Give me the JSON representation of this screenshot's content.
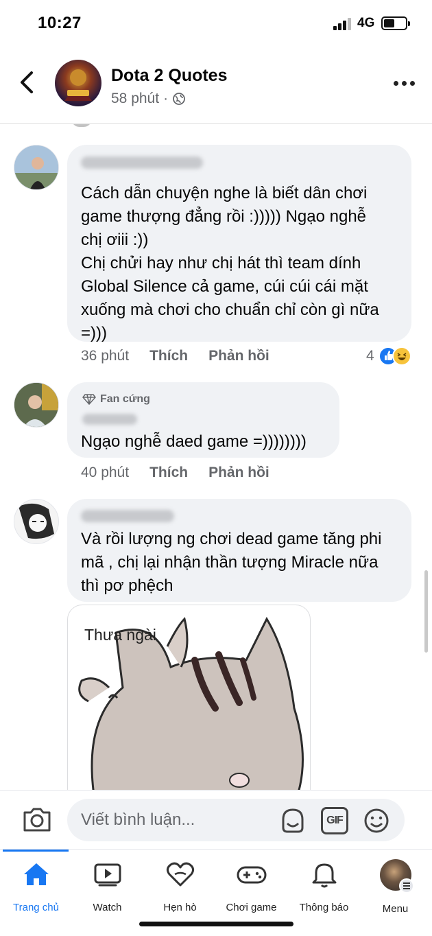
{
  "status": {
    "time": "10:27",
    "network": "4G"
  },
  "header": {
    "title": "Dota 2 Quotes",
    "subtitle": "58 phút",
    "separator": "·"
  },
  "comments": [
    {
      "badge": "",
      "text": "Cách dẫn chuyện nghe là biết dân chơi\ngame thượng đẳng rồi :))))) Ngạo nghễ\nchị ơiii :))\nChị chửi hay như chị hát thì team dính\nGlobal Silence cả game, cúi cúi cái mặt\nxuống mà chơi cho chuẩn chỉ còn gì nữa\n=)))",
      "time": "36 phút",
      "like": "Thích",
      "reply": "Phản hồi",
      "reaction_count": "4",
      "reactions": [
        "like-icon",
        "haha-icon"
      ]
    },
    {
      "badge": "Fan cứng",
      "text": "Ngạo nghễ daed game =))))))))",
      "time": "40 phút",
      "like": "Thích",
      "reply": "Phản hồi"
    },
    {
      "badge": "",
      "text": "Và rồi lượng ng chơi dead game tăng phi\nmã , chị lại nhận thần tượng Miracle nữa\nthì pơ phệch",
      "sticker_caption": "Thưa ngài"
    }
  ],
  "composer": {
    "placeholder": "Viết bình luận...",
    "gif_label": "GIF"
  },
  "tabs": [
    {
      "label": "Trang chủ",
      "icon": "home-icon",
      "active": true
    },
    {
      "label": "Watch",
      "icon": "watch-icon",
      "active": false
    },
    {
      "label": "Hẹn hò",
      "icon": "dating-heart-icon",
      "active": false
    },
    {
      "label": "Chơi game",
      "icon": "gamepad-icon",
      "active": false
    },
    {
      "label": "Thông báo",
      "icon": "bell-icon",
      "active": false
    },
    {
      "label": "Menu",
      "icon": "profile-menu-icon",
      "active": false
    }
  ],
  "colors": {
    "accent": "#1877f2",
    "bubble": "#f0f2f5",
    "meta": "#65676b"
  }
}
